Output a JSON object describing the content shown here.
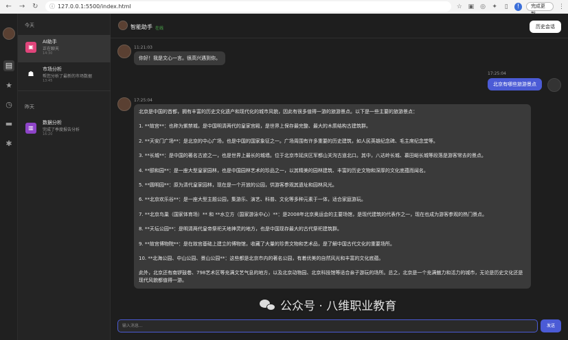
{
  "browser": {
    "url": "127.0.0.1:5500/index.html",
    "update_label": "完成更新"
  },
  "sidebar": {
    "sections": [
      {
        "label": "今天"
      },
      {
        "label": "昨天"
      }
    ],
    "conversations": [
      {
        "title": "AI助手",
        "subtitle": "正在聊天",
        "time": "14:30",
        "icon": "image-icon",
        "color": "#e0457b"
      },
      {
        "title": "市场分析",
        "subtitle": "帮您分析了最新的市场数据",
        "time": "13:45",
        "icon": "robot-icon",
        "color": "#242424"
      },
      {
        "title": "数据分析",
        "subtitle": "完成了季度报告分析",
        "time": "16:20",
        "icon": "chart-icon",
        "color": "#8e44c8"
      }
    ]
  },
  "chat": {
    "title": "智能助手",
    "status": "在线",
    "history_label": "历史会话",
    "messages": {
      "greeting_time": "11:21:03",
      "greeting": "你好！我是文心一言。很高兴遇到你。",
      "user_time": "17:25:04",
      "user_text": "北京有哪些旅游景点",
      "answer_time": "17:25:04",
      "answer": [
        "北京是中国的首都，拥有丰富的历史文化遗产和现代化的城市风貌，因此有很多值得一游的旅游景点。以下是一些主要的旅游景点：",
        "1. **故宫**：也称为紫禁城，是中国明清两代的皇家宫殿，是世界上保存最完整、最大的木质结构古建筑群。",
        "2. **天安门广场**：是北京的中心广场，也是中国的国家象征之一。广场周围有许多重要的历史建筑，如人民英雄纪念碑、毛主席纪念堂等。",
        "3. **长城**：是中国的著名古迹之一，也是世界上最长的城墙。位于北京市延庆区军都山关沟古道北口。其中，八达岭长城、慕田峪长城等段落是游客常去的景点。",
        "4. **颐和园**：是一座大型皇家园林，也是中国园林艺术的珍品之一，以其精美的园林建筑、丰富的历史文物和深厚的文化底蕴而闻名。",
        "5. **圆明园**：原为清代皇家园林，现在是一个开放的公园，供游客参观其遗址和园林风光。",
        "6. **北京欢乐谷**：是一座大型主题公园，集游乐、演艺、科普、文化等多种元素于一体，适合家庭游玩。",
        "7. **北京鸟巢（国家体育场）** 和 **水立方（国家游泳中心）**：是2008年北京奥运会的主要场馆，是现代建筑的代表作之一，现在也成为游客参观的热门景点。",
        "8. **天坛公园**：是明清两代皇帝祭祀天地神灵的地方，也是中国现存最大的古代祭祀建筑群。",
        "9. **故宫博物院**：是在故宫基础上建立的博物馆，收藏了大量的珍贵文物和艺术品，是了解中国古代文化的重要场所。",
        "10. **北海公园、中山公园、景山公园**：这些都是北京市内的著名公园，有着优美的自然风光和丰富的文化底蕴。",
        "此外，北京还有南锣鼓巷、798艺术区等充满文艺气息的地方，以及北京动物园、北京科技馆等适合亲子游玩的场所。总之，北京是一个充满魅力和活力的城市，无论是历史文化还是现代风貌都值得一游。"
      ]
    },
    "input_placeholder": "输入消息...",
    "send_label": "发送"
  },
  "watermark": "公众号 · 八维职业教育",
  "colors": {
    "accent": "#4b5bd6",
    "online": "#4cae4c"
  }
}
